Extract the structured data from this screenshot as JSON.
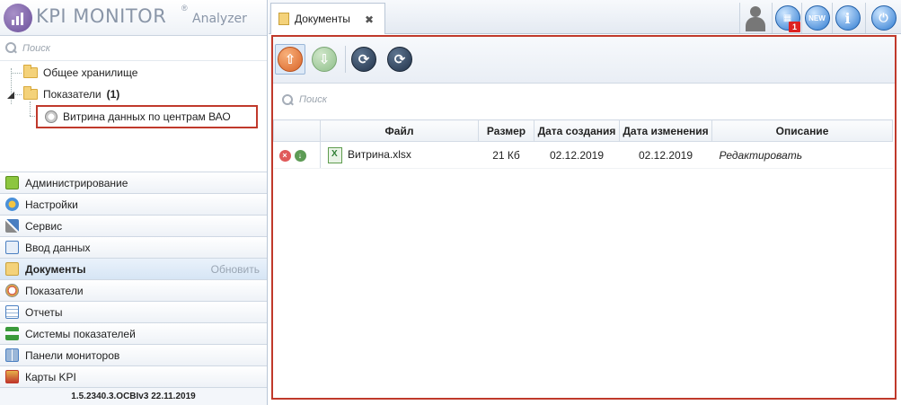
{
  "app": {
    "logo_main": "KPI MONITOR",
    "logo_reg": "®",
    "logo_sub": "Analyzer",
    "version": "1.5.2340.3.OCBIv3  22.11.2019"
  },
  "left_search": {
    "placeholder": "Поиск"
  },
  "tree": {
    "items": [
      {
        "label": "Общее хранилище"
      },
      {
        "label": "Показатели",
        "count": "(1)"
      },
      {
        "label": "Витрина данных по центрам ВАО"
      }
    ]
  },
  "nav": {
    "items": [
      {
        "label": "Администрирование",
        "icon": "admin-icon"
      },
      {
        "label": "Настройки",
        "icon": "settings-icon"
      },
      {
        "label": "Сервис",
        "icon": "tools-icon"
      },
      {
        "label": "Ввод данных",
        "icon": "data-input-icon"
      },
      {
        "label": "Документы",
        "icon": "documents-icon",
        "active": true,
        "action": "Обновить"
      },
      {
        "label": "Показатели",
        "icon": "indicators-icon"
      },
      {
        "label": "Отчеты",
        "icon": "reports-icon"
      },
      {
        "label": "Системы показателей",
        "icon": "systems-icon"
      },
      {
        "label": "Панели мониторов",
        "icon": "panels-icon"
      },
      {
        "label": "Карты KPI",
        "icon": "kpi-maps-icon"
      }
    ]
  },
  "tabs": [
    {
      "label": "Документы",
      "close": "✖"
    }
  ],
  "topbar": {
    "badge": "1",
    "new_label": "NEW",
    "info_label": "i"
  },
  "main_search": {
    "placeholder": "Поиск"
  },
  "grid": {
    "columns": [
      "Файл",
      "Размер",
      "Дата создания",
      "Дата изменения",
      "Описание"
    ],
    "rows": [
      {
        "file": "Витрина.xlsx",
        "size": "21 Кб",
        "created": "02.12.2019",
        "modified": "02.12.2019",
        "description": "Редактировать"
      }
    ]
  },
  "colors": {
    "accent_red": "#c0392b",
    "upload": "#e07b39",
    "download": "#8fbf8a",
    "dark_btn": "#2e3f52"
  }
}
